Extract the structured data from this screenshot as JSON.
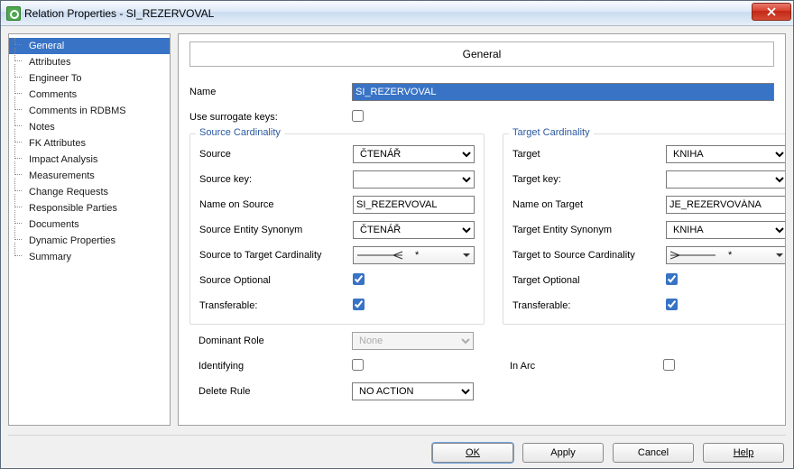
{
  "window": {
    "title": "Relation Properties - SI_REZERVOVAL"
  },
  "nav": {
    "items": [
      "General",
      "Attributes",
      "Engineer To",
      "Comments",
      "Comments in RDBMS",
      "Notes",
      "FK Attributes",
      "Impact Analysis",
      "Measurements",
      "Change Requests",
      "Responsible Parties",
      "Documents",
      "Dynamic Properties",
      "Summary"
    ],
    "selected_index": 0
  },
  "header": "General",
  "fields": {
    "name_label": "Name",
    "name_value": "SI_REZERVOVAL",
    "surrogate_label": "Use surrogate keys:",
    "surrogate_checked": false,
    "dominant_label": "Dominant Role",
    "dominant_value": "None",
    "identifying_label": "Identifying",
    "identifying_checked": false,
    "inarc_label": "In Arc",
    "inarc_checked": false,
    "delete_label": "Delete Rule",
    "delete_value": "NO ACTION"
  },
  "source": {
    "title": "Source Cardinality",
    "entity_label": "Source",
    "entity_value": "ČTENÁŘ",
    "key_label": "Source key:",
    "key_value": "",
    "name_on_label": "Name on Source",
    "name_on_value": "SI_REZERVOVAL",
    "syn_label": "Source Entity Synonym",
    "syn_value": "ČTENÁŘ",
    "card_label": "Source to Target Cardinality",
    "card_value": "*",
    "optional_label": "Source Optional",
    "optional_checked": true,
    "transferable_label": "Transferable:",
    "transferable_checked": true
  },
  "target": {
    "title": "Target Cardinality",
    "entity_label": "Target",
    "entity_value": "KNIHA",
    "key_label": "Target key:",
    "key_value": "",
    "name_on_label": "Name on Target",
    "name_on_value": "JE_REZERVOVÁNA",
    "syn_label": "Target Entity Synonym",
    "syn_value": "KNIHA",
    "card_label": "Target to Source Cardinality",
    "card_value": "*",
    "optional_label": "Target Optional",
    "optional_checked": true,
    "transferable_label": "Transferable:",
    "transferable_checked": true
  },
  "buttons": {
    "ok": "OK",
    "apply": "Apply",
    "cancel": "Cancel",
    "help": "Help"
  }
}
